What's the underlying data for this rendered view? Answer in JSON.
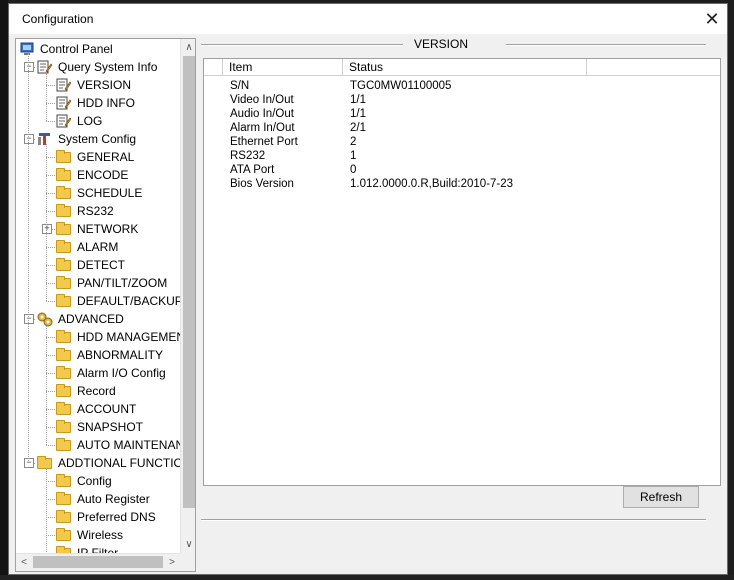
{
  "window": {
    "title": "Configuration",
    "close_glyph": "✕"
  },
  "tree": {
    "items": [
      {
        "label": "Control Panel",
        "icon": "monitor-icon",
        "level": 0
      },
      {
        "label": "Query System Info",
        "icon": "document-icon",
        "level": 1,
        "expander": "−"
      },
      {
        "label": "VERSION",
        "icon": "document-icon",
        "level": 2
      },
      {
        "label": "HDD INFO",
        "icon": "document-icon",
        "level": 2
      },
      {
        "label": "LOG",
        "icon": "document-icon",
        "level": 2
      },
      {
        "label": "System Config",
        "icon": "tools-icon",
        "level": 1,
        "expander": "−"
      },
      {
        "label": "GENERAL",
        "icon": "folder-icon",
        "level": 2
      },
      {
        "label": "ENCODE",
        "icon": "folder-icon",
        "level": 2
      },
      {
        "label": "SCHEDULE",
        "icon": "folder-icon",
        "level": 2
      },
      {
        "label": "RS232",
        "icon": "folder-icon",
        "level": 2
      },
      {
        "label": "NETWORK",
        "icon": "folder-icon",
        "level": 2,
        "expander": "+"
      },
      {
        "label": "ALARM",
        "icon": "folder-icon",
        "level": 2
      },
      {
        "label": "DETECT",
        "icon": "folder-icon",
        "level": 2
      },
      {
        "label": "PAN/TILT/ZOOM",
        "icon": "folder-icon",
        "level": 2
      },
      {
        "label": "DEFAULT/BACKUP",
        "icon": "folder-icon",
        "level": 2
      },
      {
        "label": "ADVANCED",
        "icon": "gears-icon",
        "level": 1,
        "expander": "−"
      },
      {
        "label": "HDD MANAGEMENT",
        "icon": "folder-icon",
        "level": 2
      },
      {
        "label": "ABNORMALITY",
        "icon": "folder-icon",
        "level": 2
      },
      {
        "label": "Alarm I/O Config",
        "icon": "folder-icon",
        "level": 2
      },
      {
        "label": "Record",
        "icon": "folder-icon",
        "level": 2
      },
      {
        "label": "ACCOUNT",
        "icon": "folder-icon",
        "level": 2
      },
      {
        "label": "SNAPSHOT",
        "icon": "folder-icon",
        "level": 2
      },
      {
        "label": "AUTO MAINTENANCE",
        "icon": "folder-icon",
        "level": 2
      },
      {
        "label": "ADDTIONAL FUNCTION",
        "icon": "folder-icon",
        "level": 1,
        "expander": "−"
      },
      {
        "label": "Config",
        "icon": "folder-icon",
        "level": 2
      },
      {
        "label": "Auto Register",
        "icon": "folder-icon",
        "level": 2
      },
      {
        "label": "Preferred DNS",
        "icon": "folder-icon",
        "level": 2
      },
      {
        "label": "Wireless",
        "icon": "folder-icon",
        "level": 2
      },
      {
        "label": "IP Filter",
        "icon": "folder-icon",
        "level": 2
      }
    ],
    "scroll_up": "∧",
    "scroll_down": "∨",
    "scroll_left": "<",
    "scroll_right": ">"
  },
  "panel": {
    "group_title": "VERSION",
    "columns": [
      "Item",
      "Status",
      ""
    ],
    "rows": [
      {
        "item": "S/N",
        "status": "TGC0MW01100005"
      },
      {
        "item": "Video In/Out",
        "status": "1/1"
      },
      {
        "item": "Audio In/Out",
        "status": "1/1"
      },
      {
        "item": "Alarm In/Out",
        "status": "2/1"
      },
      {
        "item": "Ethernet Port",
        "status": "2"
      },
      {
        "item": "RS232",
        "status": "1"
      },
      {
        "item": "ATA Port",
        "status": "0"
      },
      {
        "item": "Bios Version",
        "status": "1.012.0000.0.R,Build:2010-7-23"
      }
    ],
    "refresh_label": "Refresh"
  }
}
